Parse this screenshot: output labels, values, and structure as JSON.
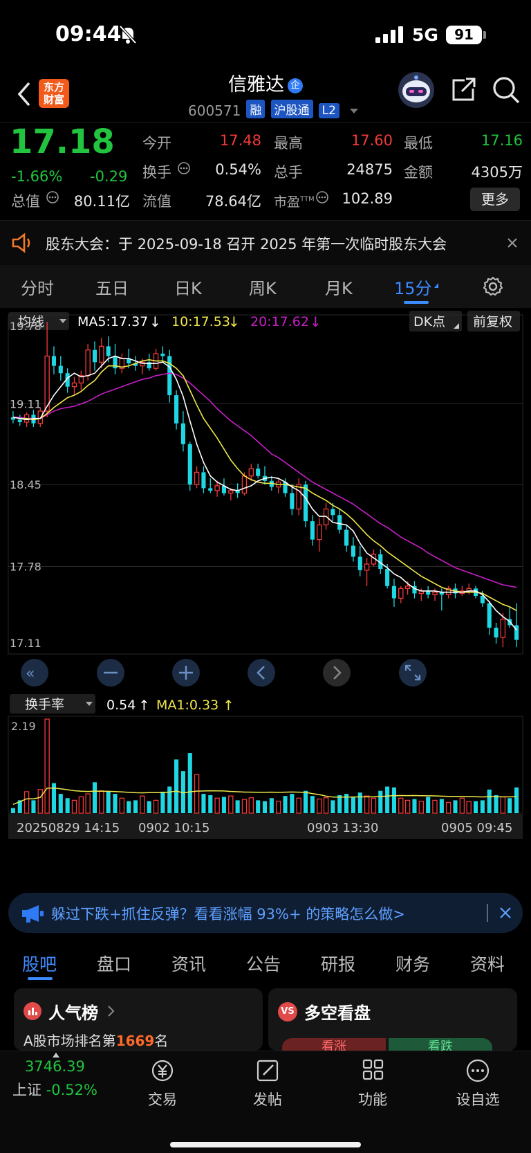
{
  "status_bar": {
    "time": "09:44",
    "network": "5G",
    "battery": "91"
  },
  "header": {
    "broker_logo_line1": "东方",
    "broker_logo_line2": "财富",
    "stock_name": "信雅达",
    "stock_badge": "企",
    "stock_code": "600571",
    "tags": [
      "融",
      "沪股通",
      "L2"
    ]
  },
  "quote": {
    "price": "17.18",
    "change_pct": "-1.66%",
    "change": "-0.29",
    "stats": [
      {
        "label": "今开",
        "value": "17.48",
        "tone": "red"
      },
      {
        "label": "最高",
        "value": "17.60",
        "tone": "red"
      },
      {
        "label": "最低",
        "value": "17.16",
        "tone": "green"
      },
      {
        "label": "换手",
        "value": "0.54%",
        "tone": "white"
      },
      {
        "label": "总手",
        "value": "24875",
        "tone": "white"
      },
      {
        "label": "金额",
        "value": "4305万",
        "tone": "white"
      },
      {
        "label": "总值",
        "value": "80.11亿",
        "tone": "white"
      },
      {
        "label": "流值",
        "value": "78.64亿",
        "tone": "white"
      },
      {
        "label": "市盈",
        "value": "102.89",
        "tone": "white"
      }
    ],
    "pe_sup": "TTM",
    "more_label": "更多"
  },
  "notice": {
    "text": "股东大会：于 2025-09-18 召开 2025 年第一次临时股东大会"
  },
  "chart_tabs": [
    "分时",
    "五日",
    "日K",
    "周K",
    "月K",
    "15分"
  ],
  "chart_tabs_active": 5,
  "kline_toolbar": {
    "indicator": "均线",
    "ma5": "MA5:17.37",
    "ma10": "10:17.53",
    "ma20": "20:17.62",
    "dk_label": "DK点",
    "adjust_label": "前复权",
    "volume_indicator": "换手率",
    "volume_value": "0.54",
    "volume_ma": "MA1:0.33"
  },
  "colors": {
    "up": "#f23a3a",
    "down": "#1fd7e2",
    "ma5": "#ffffff",
    "ma10": "#f0e84a",
    "ma20": "#c81ec8",
    "accent": "#2f7bf5"
  },
  "chart_data": {
    "type": "candlestick",
    "y_axis_labels": [
      "19.78",
      "19.11",
      "18.45",
      "17.78",
      "17.11"
    ],
    "ylim": [
      17.11,
      19.78
    ],
    "volume_axis_label": "2.19",
    "volume_ylim": [
      0,
      2.19
    ],
    "x_labels": [
      "20250829 14:15",
      "0902 10:15",
      "0903 13:30",
      "0905 09:45"
    ],
    "candles": [
      [
        19.0,
        19.05,
        18.95,
        18.98
      ],
      [
        18.98,
        19.02,
        18.93,
        18.96
      ],
      [
        18.96,
        19.04,
        18.92,
        19.02
      ],
      [
        19.02,
        19.06,
        18.92,
        18.95
      ],
      [
        18.95,
        19.08,
        18.92,
        19.05
      ],
      [
        19.05,
        19.78,
        19.0,
        19.5
      ],
      [
        19.5,
        19.58,
        19.35,
        19.42
      ],
      [
        19.42,
        19.5,
        19.3,
        19.36
      ],
      [
        19.36,
        19.4,
        19.2,
        19.25
      ],
      [
        19.25,
        19.33,
        19.18,
        19.28
      ],
      [
        19.28,
        19.38,
        19.22,
        19.34
      ],
      [
        19.34,
        19.6,
        19.3,
        19.55
      ],
      [
        19.55,
        19.62,
        19.38,
        19.45
      ],
      [
        19.45,
        19.65,
        19.4,
        19.58
      ],
      [
        19.58,
        19.66,
        19.45,
        19.5
      ],
      [
        19.5,
        19.6,
        19.35,
        19.4
      ],
      [
        19.4,
        19.52,
        19.36,
        19.48
      ],
      [
        19.48,
        19.56,
        19.4,
        19.44
      ],
      [
        19.44,
        19.5,
        19.38,
        19.42
      ],
      [
        19.42,
        19.48,
        19.35,
        19.45
      ],
      [
        19.45,
        19.52,
        19.38,
        19.4
      ],
      [
        19.4,
        19.56,
        19.38,
        19.52
      ],
      [
        19.52,
        19.58,
        19.45,
        19.5
      ],
      [
        19.5,
        19.55,
        19.12,
        19.18
      ],
      [
        19.18,
        19.22,
        18.9,
        18.95
      ],
      [
        18.95,
        19.05,
        18.72,
        18.78
      ],
      [
        18.78,
        18.8,
        18.4,
        18.45
      ],
      [
        18.45,
        18.6,
        18.42,
        18.55
      ],
      [
        18.55,
        18.6,
        18.38,
        18.42
      ],
      [
        18.42,
        18.5,
        18.38,
        18.4
      ],
      [
        18.4,
        18.48,
        18.35,
        18.44
      ],
      [
        18.44,
        18.5,
        18.36,
        18.38
      ],
      [
        18.38,
        18.42,
        18.32,
        18.4
      ],
      [
        18.4,
        18.46,
        18.34,
        18.38
      ],
      [
        18.38,
        18.55,
        18.36,
        18.52
      ],
      [
        18.52,
        18.62,
        18.48,
        18.58
      ],
      [
        18.58,
        18.62,
        18.5,
        18.52
      ],
      [
        18.52,
        18.6,
        18.45,
        18.48
      ],
      [
        18.48,
        18.52,
        18.4,
        18.43
      ],
      [
        18.43,
        18.5,
        18.38,
        18.47
      ],
      [
        18.47,
        18.5,
        18.35,
        18.38
      ],
      [
        18.38,
        18.45,
        18.2,
        18.25
      ],
      [
        18.25,
        18.5,
        18.2,
        18.45
      ],
      [
        18.45,
        18.48,
        18.1,
        18.15
      ],
      [
        18.15,
        18.2,
        17.95,
        18.0
      ],
      [
        18.0,
        18.18,
        17.9,
        18.12
      ],
      [
        18.12,
        18.3,
        18.08,
        18.25
      ],
      [
        18.25,
        18.3,
        18.15,
        18.2
      ],
      [
        18.2,
        18.25,
        18.05,
        18.08
      ],
      [
        18.08,
        18.12,
        17.9,
        17.95
      ],
      [
        17.95,
        18.02,
        17.82,
        17.86
      ],
      [
        17.86,
        17.95,
        17.7,
        17.75
      ],
      [
        17.75,
        17.85,
        17.62,
        17.8
      ],
      [
        17.8,
        17.92,
        17.78,
        17.88
      ],
      [
        17.88,
        17.92,
        17.72,
        17.76
      ],
      [
        17.76,
        17.8,
        17.6,
        17.62
      ],
      [
        17.62,
        17.68,
        17.45,
        17.52
      ],
      [
        17.52,
        17.62,
        17.48,
        17.6
      ],
      [
        17.6,
        17.66,
        17.55,
        17.62
      ],
      [
        17.62,
        17.66,
        17.52,
        17.56
      ],
      [
        17.56,
        17.6,
        17.5,
        17.58
      ],
      [
        17.58,
        17.62,
        17.52,
        17.55
      ],
      [
        17.55,
        17.6,
        17.5,
        17.57
      ],
      [
        17.57,
        17.6,
        17.42,
        17.55
      ],
      [
        17.55,
        17.62,
        17.52,
        17.6
      ],
      [
        17.6,
        17.64,
        17.52,
        17.56
      ],
      [
        17.56,
        17.62,
        17.54,
        17.58
      ],
      [
        17.58,
        17.64,
        17.55,
        17.6
      ],
      [
        17.6,
        17.62,
        17.52,
        17.54
      ],
      [
        17.54,
        17.58,
        17.45,
        17.48
      ],
      [
        17.48,
        17.5,
        17.22,
        17.28
      ],
      [
        17.28,
        17.32,
        17.15,
        17.2
      ],
      [
        17.2,
        17.4,
        17.12,
        17.35
      ],
      [
        17.35,
        17.45,
        17.28,
        17.3
      ],
      [
        17.3,
        17.48,
        17.12,
        17.18
      ]
    ],
    "turnover": [
      0.12,
      0.3,
      0.5,
      0.3,
      0.55,
      2.19,
      0.7,
      0.45,
      0.35,
      0.3,
      0.38,
      0.45,
      0.72,
      0.52,
      0.5,
      0.45,
      0.35,
      0.28,
      0.3,
      0.4,
      0.28,
      0.3,
      0.5,
      0.62,
      1.25,
      0.98,
      1.4,
      0.9,
      0.45,
      0.42,
      0.35,
      0.38,
      0.4,
      0.3,
      0.32,
      0.36,
      0.3,
      0.28,
      0.35,
      0.28,
      0.4,
      0.45,
      0.35,
      0.52,
      0.4,
      0.33,
      0.36,
      0.3,
      0.42,
      0.45,
      0.38,
      0.48,
      0.4,
      0.35,
      0.52,
      0.62,
      0.6,
      0.35,
      0.3,
      0.33,
      0.28,
      0.38,
      0.3,
      0.33,
      0.25,
      0.3,
      0.35,
      0.27,
      0.28,
      0.3,
      0.55,
      0.42,
      0.38,
      0.35,
      0.6
    ],
    "ma5": [
      19.0,
      18.99,
      18.98,
      18.99,
      18.99,
      19.09,
      19.18,
      19.25,
      19.32,
      19.36,
      19.33,
      19.34,
      19.36,
      19.42,
      19.48,
      19.5,
      19.48,
      19.48,
      19.46,
      19.44,
      19.44,
      19.44,
      19.45,
      19.41,
      19.31,
      19.17,
      18.97,
      18.78,
      18.63,
      18.52,
      18.47,
      18.44,
      18.41,
      18.4,
      18.42,
      18.44,
      18.48,
      18.5,
      18.51,
      18.5,
      18.47,
      18.43,
      18.4,
      18.34,
      18.25,
      18.19,
      18.19,
      18.14,
      18.13,
      18.12,
      18.07,
      17.97,
      17.89,
      17.85,
      17.81,
      17.77,
      17.72,
      17.69,
      17.64,
      17.6,
      17.58,
      17.58,
      17.58,
      17.57,
      17.57,
      17.57,
      17.57,
      17.58,
      17.58,
      17.55,
      17.49,
      17.42,
      17.37,
      17.33,
      17.26
    ],
    "ma10": [
      19.0,
      18.99,
      18.99,
      18.98,
      18.99,
      19.03,
      19.08,
      19.12,
      19.16,
      19.18,
      19.21,
      19.26,
      19.3,
      19.37,
      19.42,
      19.42,
      19.41,
      19.42,
      19.44,
      19.46,
      19.47,
      19.46,
      19.46,
      19.44,
      19.4,
      19.34,
      19.22,
      19.1,
      18.99,
      18.91,
      18.83,
      18.74,
      18.65,
      18.58,
      18.52,
      18.49,
      18.47,
      18.46,
      18.46,
      18.45,
      18.45,
      18.44,
      18.43,
      18.42,
      18.38,
      18.35,
      18.32,
      18.28,
      18.25,
      18.21,
      18.16,
      18.1,
      18.04,
      17.99,
      17.95,
      17.9,
      17.86,
      17.82,
      17.78,
      17.74,
      17.7,
      17.67,
      17.64,
      17.61,
      17.59,
      17.58,
      17.57,
      17.57,
      17.57,
      17.56,
      17.53,
      17.5,
      17.47,
      17.45,
      17.42
    ],
    "ma20": [
      19.0,
      19.0,
      18.99,
      18.99,
      18.99,
      19.02,
      19.05,
      19.07,
      19.08,
      19.09,
      19.11,
      19.13,
      19.16,
      19.19,
      19.21,
      19.23,
      19.25,
      19.27,
      19.29,
      19.31,
      19.32,
      19.34,
      19.35,
      19.36,
      19.35,
      19.32,
      19.28,
      19.23,
      19.18,
      19.13,
      19.07,
      19.02,
      18.97,
      18.93,
      18.89,
      18.85,
      18.8,
      18.75,
      18.7,
      18.67,
      18.63,
      18.59,
      18.55,
      18.51,
      18.47,
      18.44,
      18.41,
      18.38,
      18.35,
      18.32,
      18.29,
      18.25,
      18.21,
      18.17,
      18.13,
      18.1,
      18.06,
      18.02,
      17.99,
      17.96,
      17.93,
      17.89,
      17.86,
      17.83,
      17.8,
      17.77,
      17.75,
      17.73,
      17.71,
      17.69,
      17.67,
      17.65,
      17.63,
      17.62,
      17.61
    ]
  },
  "promo": {
    "text": "躲过下跌+抓住反弹？看看涨幅 93%+ 的策略怎么做>"
  },
  "bottom_tabs": [
    "股吧",
    "盘口",
    "资讯",
    "公告",
    "研报",
    "财务",
    "资料"
  ],
  "bottom_tabs_active": 0,
  "cards": {
    "left_title": "人气榜",
    "left_sub_prefix": "A股市场排名第",
    "left_rank": "1669",
    "left_sub_suffix": "名",
    "right_badge": "VS",
    "right_title": "多空看盘",
    "right_bull": "看涨",
    "right_bear": "看跌"
  },
  "bottom_nav": {
    "index_value": "3746.39",
    "index_name": "上证",
    "index_change": "-0.52%",
    "items": [
      "交易",
      "发帖",
      "功能",
      "设自选"
    ]
  }
}
